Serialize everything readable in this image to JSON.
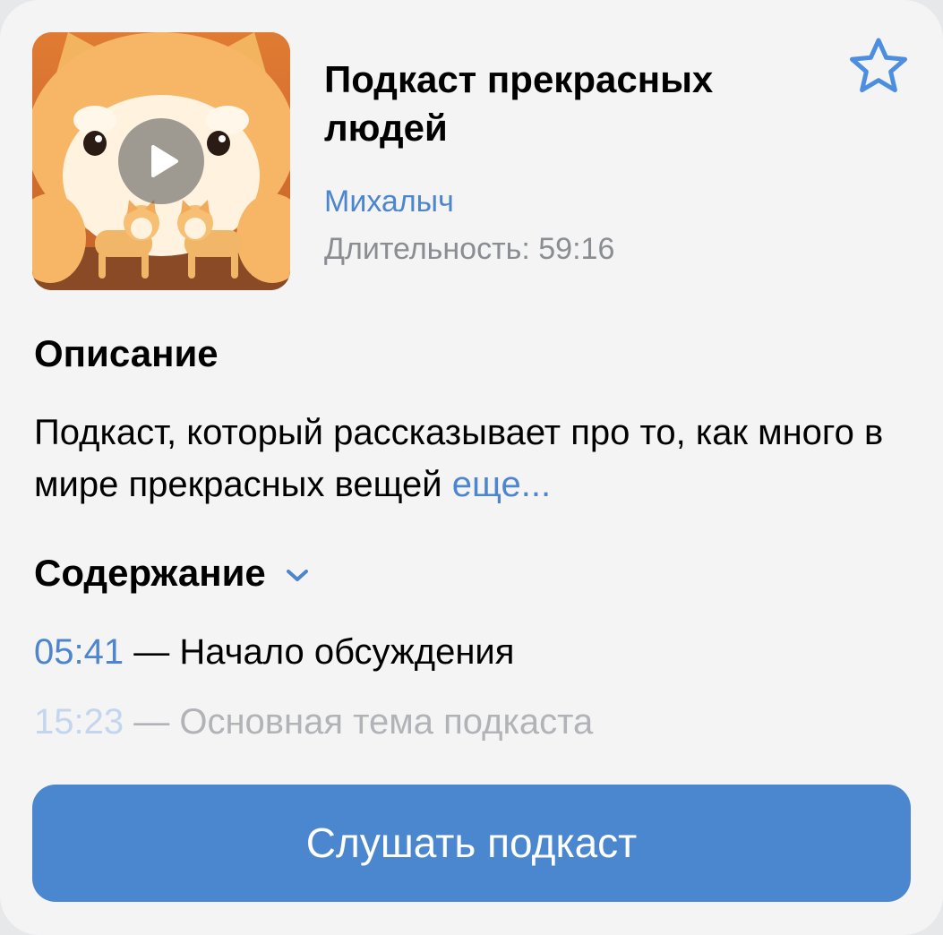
{
  "podcast": {
    "title": "Подкаст прекрасных людей",
    "author": "Михалыч",
    "duration_label": "Длительность:",
    "duration_value": "59:16",
    "cover_icon": "shiba-dog-illustration",
    "play_icon": "play-icon",
    "favorite_icon": "star-outline-icon"
  },
  "description": {
    "heading": "Описание",
    "text": "Подкаст, который рассказывает про то, как много в мире прекрасных вещей",
    "more_label": "еще..."
  },
  "contents": {
    "heading": "Содержание",
    "toggle_icon": "chevron-down-icon",
    "items": [
      {
        "time": "05:41",
        "label": "— Начало обсуждения"
      },
      {
        "time": "15:23",
        "label": "— Основная тема подкаста"
      }
    ]
  },
  "actions": {
    "listen_label": "Слушать подкаст"
  },
  "colors": {
    "accent": "#4b87ce",
    "link": "#4d86cf",
    "card_background": "#f4f4f5",
    "secondary_text": "#8a8d92"
  }
}
